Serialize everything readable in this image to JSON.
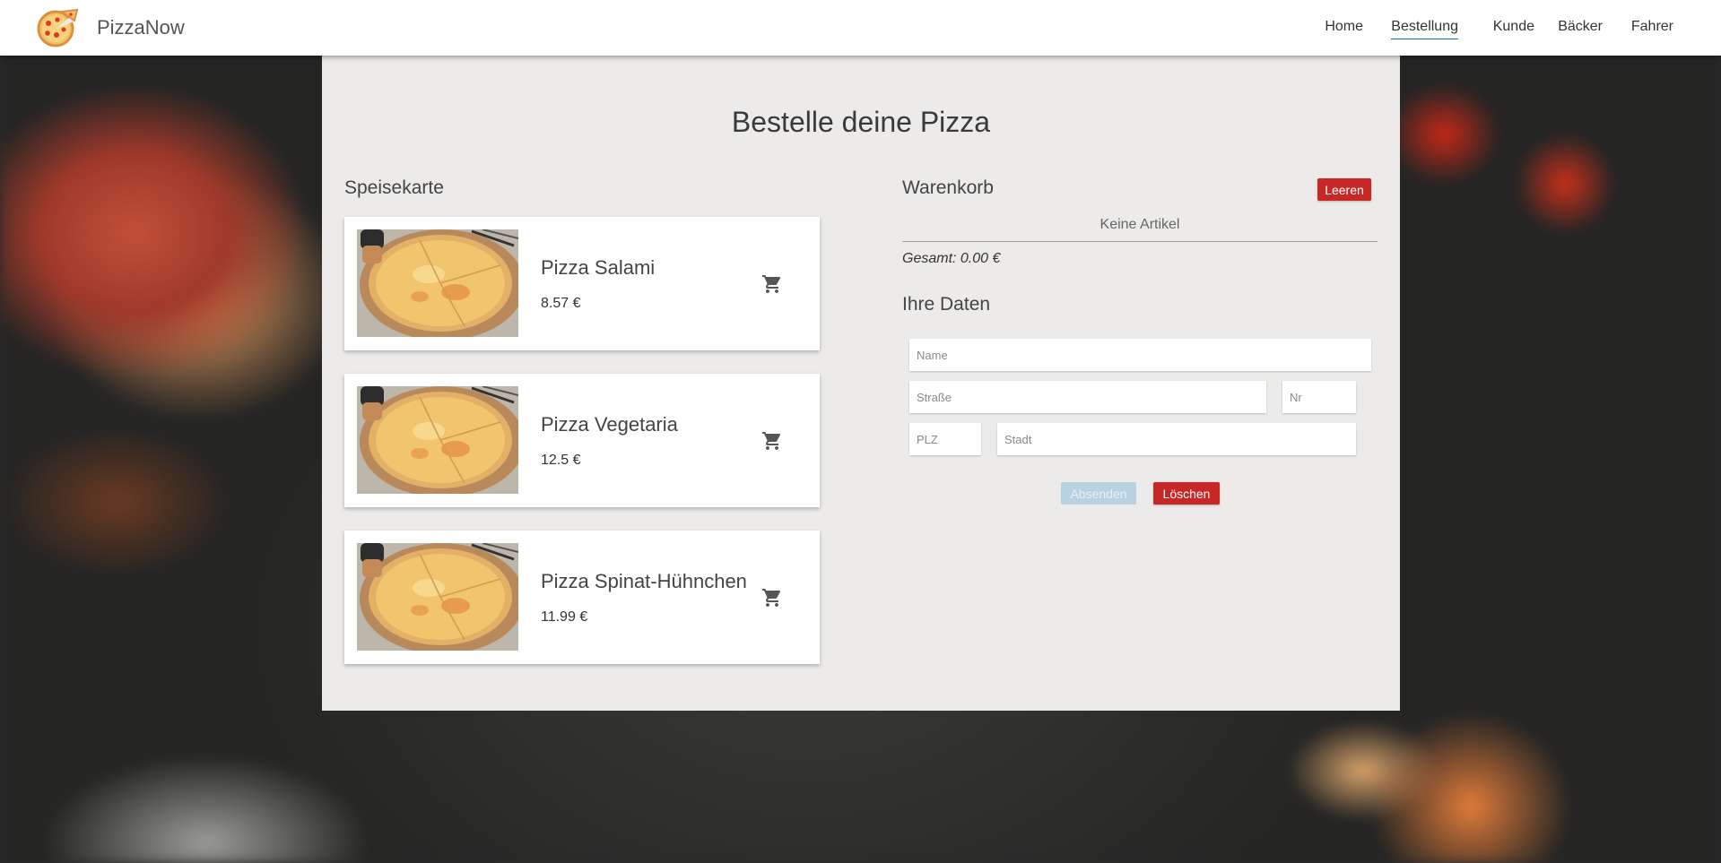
{
  "header": {
    "brand": "PizzaNow",
    "nav": [
      {
        "label": "Home",
        "active": false
      },
      {
        "label": "Bestellung",
        "active": true
      },
      {
        "label": "Kunde",
        "active": false
      },
      {
        "label": "Bäcker",
        "active": false
      },
      {
        "label": "Fahrer",
        "active": false
      }
    ]
  },
  "page_title": "Bestelle deine Pizza",
  "menu": {
    "title": "Speisekarte",
    "items": [
      {
        "name": "Pizza Salami",
        "price": "8.57 €"
      },
      {
        "name": "Pizza Vegetaria",
        "price": "12.5 €"
      },
      {
        "name": "Pizza Spinat-Hühnchen",
        "price": "11.99 €"
      }
    ]
  },
  "cart": {
    "title": "Warenkorb",
    "clear_label": "Leeren",
    "empty_text": "Keine Artikel",
    "total": "Gesamt: 0.00 €"
  },
  "form": {
    "title": "Ihre Daten",
    "name_placeholder": "Name",
    "street_placeholder": "Straße",
    "nr_placeholder": "Nr",
    "zip_placeholder": "PLZ",
    "city_placeholder": "Stadt",
    "submit_label": "Absenden",
    "delete_label": "Löschen"
  },
  "colors": {
    "accent_red": "#c62828",
    "disabled_blue": "#b7d2e2",
    "active_nav_underline": "#1565c0",
    "panel_bg": "#ecebe9"
  },
  "icons": [
    "pizza-logo-icon",
    "shopping-cart-icon"
  ]
}
